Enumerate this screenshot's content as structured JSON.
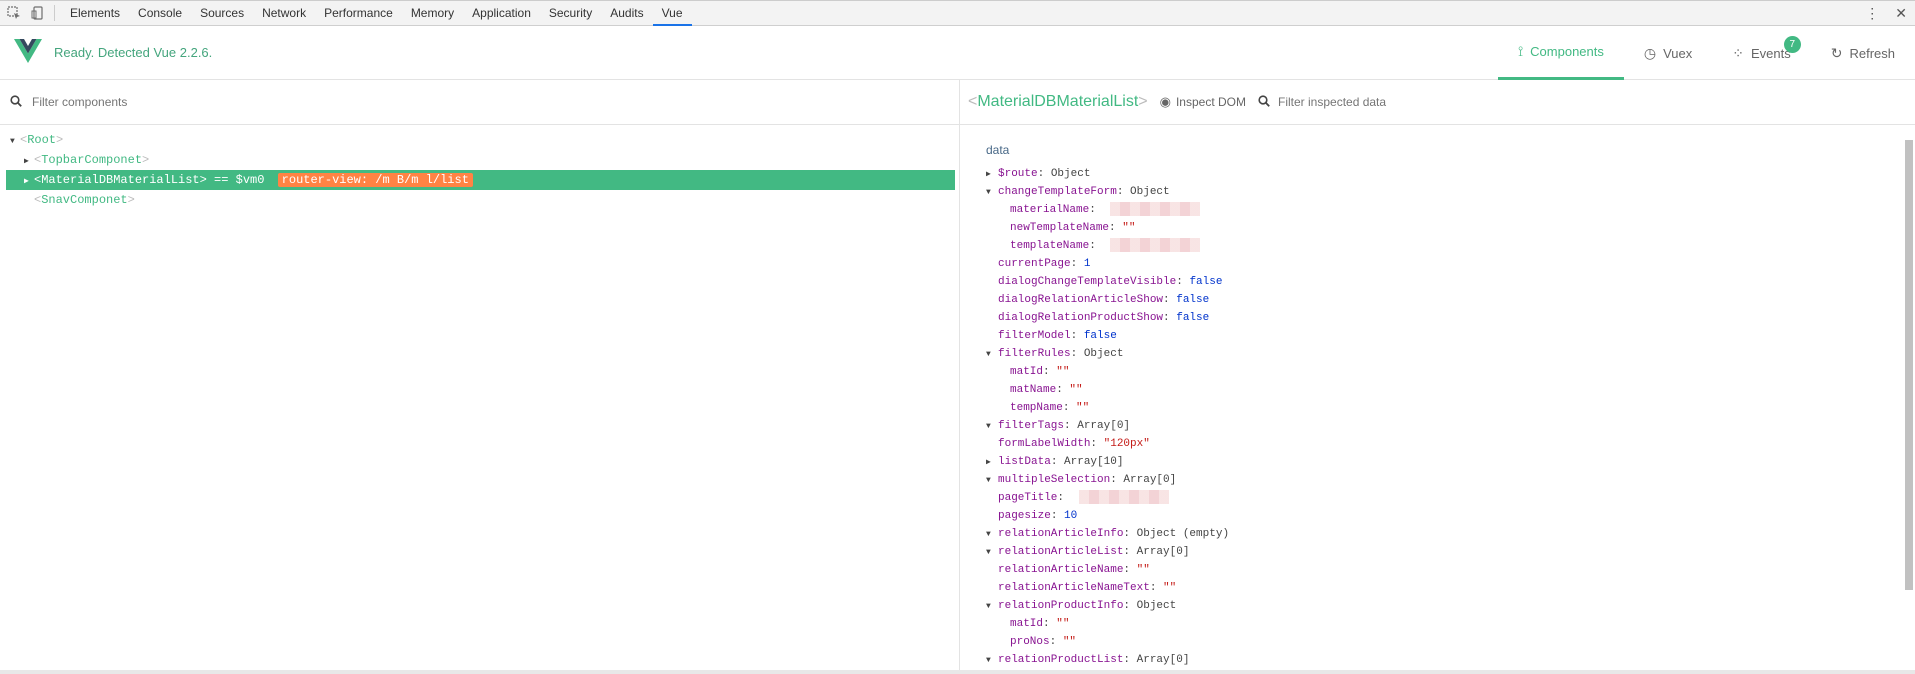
{
  "devtools": {
    "tabs": [
      "Elements",
      "Console",
      "Sources",
      "Network",
      "Performance",
      "Memory",
      "Application",
      "Security",
      "Audits",
      "Vue"
    ],
    "active_tab": "Vue",
    "more_icon": "kebab-menu-icon",
    "close_icon": "close-icon"
  },
  "vue": {
    "status": "Ready. Detected Vue 2.2.6.",
    "tabs": {
      "components": "Components",
      "vuex": "Vuex",
      "events": "Events",
      "events_badge": "7",
      "refresh": "Refresh"
    }
  },
  "left": {
    "filter_placeholder": "Filter components",
    "tree": {
      "root": "Root",
      "topbar": "TopbarComponet",
      "material": "MaterialDBMaterialList",
      "vm_ref": "== $vm0",
      "router": "router-view: /m         B/m       l/list",
      "snav": "SnavComponet"
    }
  },
  "right": {
    "component_name": "MaterialDBMaterialList",
    "inspect_dom": "Inspect DOM",
    "filter_placeholder": "Filter inspected data",
    "data_title": "data",
    "props": [
      {
        "k": "$route",
        "sep": ": ",
        "v": "Object",
        "t": "obj",
        "arrow": "right",
        "indent": 0
      },
      {
        "k": "changeTemplateForm",
        "sep": ": ",
        "v": "Object",
        "t": "obj",
        "arrow": "down",
        "indent": 0
      },
      {
        "k": "materialName",
        "sep": ": ",
        "v": "",
        "t": "blur",
        "arrow": "",
        "indent": 1
      },
      {
        "k": "newTemplateName",
        "sep": ": ",
        "v": "\"\"",
        "t": "str",
        "arrow": "",
        "indent": 1
      },
      {
        "k": "templateName",
        "sep": ": ",
        "v": "",
        "t": "blur",
        "arrow": "",
        "indent": 1
      },
      {
        "k": "currentPage",
        "sep": ": ",
        "v": "1",
        "t": "num",
        "arrow": "",
        "indent": 0
      },
      {
        "k": "dialogChangeTemplateVisible",
        "sep": ": ",
        "v": "false",
        "t": "bool",
        "arrow": "",
        "indent": 0
      },
      {
        "k": "dialogRelationArticleShow",
        "sep": ": ",
        "v": "false",
        "t": "bool",
        "arrow": "",
        "indent": 0
      },
      {
        "k": "dialogRelationProductShow",
        "sep": ": ",
        "v": "false",
        "t": "bool",
        "arrow": "",
        "indent": 0
      },
      {
        "k": "filterModel",
        "sep": ": ",
        "v": "false",
        "t": "bool",
        "arrow": "",
        "indent": 0
      },
      {
        "k": "filterRules",
        "sep": ": ",
        "v": "Object",
        "t": "obj",
        "arrow": "down",
        "indent": 0
      },
      {
        "k": "matId",
        "sep": ": ",
        "v": "\"\"",
        "t": "str",
        "arrow": "",
        "indent": 1
      },
      {
        "k": "matName",
        "sep": ": ",
        "v": "\"\"",
        "t": "str",
        "arrow": "",
        "indent": 1
      },
      {
        "k": "tempName",
        "sep": ": ",
        "v": "\"\"",
        "t": "str",
        "arrow": "",
        "indent": 1
      },
      {
        "k": "filterTags",
        "sep": ": ",
        "v": "Array[0]",
        "t": "obj",
        "arrow": "down",
        "indent": 0
      },
      {
        "k": "formLabelWidth",
        "sep": ": ",
        "v": "\"120px\"",
        "t": "str",
        "arrow": "",
        "indent": 0
      },
      {
        "k": "listData",
        "sep": ": ",
        "v": "Array[10]",
        "t": "obj",
        "arrow": "right",
        "indent": 0
      },
      {
        "k": "multipleSelection",
        "sep": ": ",
        "v": "Array[0]",
        "t": "obj",
        "arrow": "down",
        "indent": 0
      },
      {
        "k": "pageTitle",
        "sep": ": ",
        "v": "",
        "t": "blur",
        "arrow": "",
        "indent": 0
      },
      {
        "k": "pagesize",
        "sep": ": ",
        "v": "10",
        "t": "num",
        "arrow": "",
        "indent": 0
      },
      {
        "k": "relationArticleInfo",
        "sep": ": ",
        "v": "Object (empty)",
        "t": "obj",
        "arrow": "down",
        "indent": 0
      },
      {
        "k": "relationArticleList",
        "sep": ": ",
        "v": "Array[0]",
        "t": "obj",
        "arrow": "down",
        "indent": 0
      },
      {
        "k": "relationArticleName",
        "sep": ": ",
        "v": "\"\"",
        "t": "str",
        "arrow": "",
        "indent": 0
      },
      {
        "k": "relationArticleNameText",
        "sep": ": ",
        "v": "\"\"",
        "t": "str",
        "arrow": "",
        "indent": 0
      },
      {
        "k": "relationProductInfo",
        "sep": ": ",
        "v": "Object",
        "t": "obj",
        "arrow": "down",
        "indent": 0
      },
      {
        "k": "matId",
        "sep": ": ",
        "v": "\"\"",
        "t": "str",
        "arrow": "",
        "indent": 1
      },
      {
        "k": "proNos",
        "sep": ": ",
        "v": "\"\"",
        "t": "str",
        "arrow": "",
        "indent": 1
      },
      {
        "k": "relationProductList",
        "sep": ": ",
        "v": "Array[0]",
        "t": "obj",
        "arrow": "down",
        "indent": 0
      }
    ]
  }
}
